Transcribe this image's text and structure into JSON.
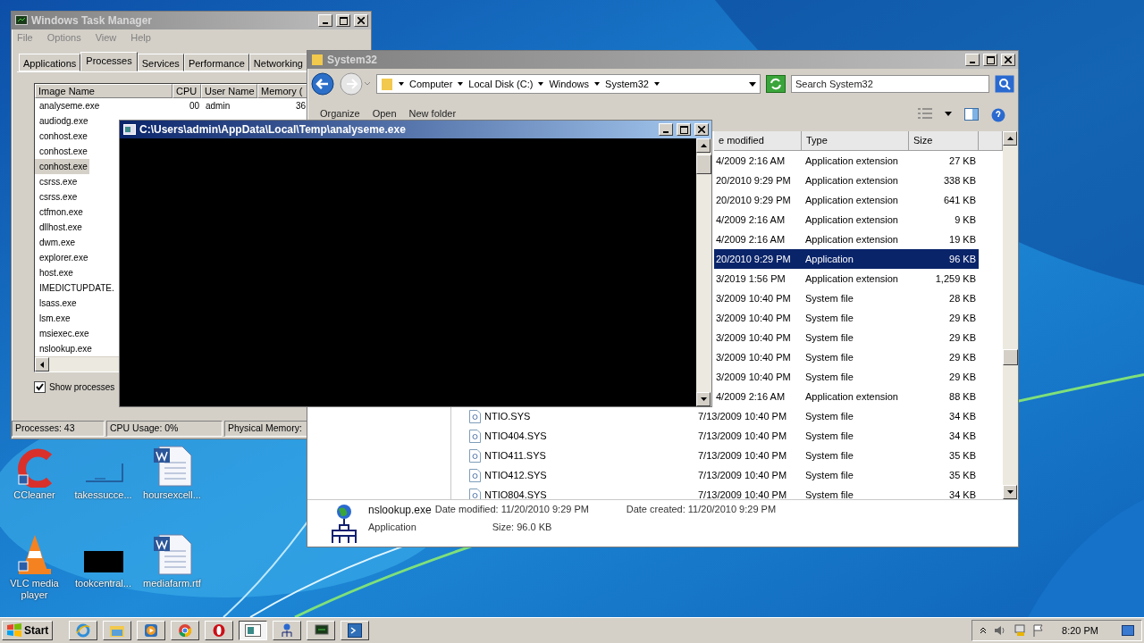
{
  "task_manager": {
    "title": "Windows Task Manager",
    "menu": [
      "File",
      "Options",
      "View",
      "Help"
    ],
    "tabs": [
      {
        "label": "Applications",
        "selected": false
      },
      {
        "label": "Processes",
        "selected": true
      },
      {
        "label": "Services",
        "selected": false
      },
      {
        "label": "Performance",
        "selected": false
      },
      {
        "label": "Networking",
        "selected": false
      }
    ],
    "columns": [
      "Image Name",
      "CPU",
      "User Name",
      "Memory ("
    ],
    "processes": [
      {
        "name": "analyseme.exe",
        "cpu": "00",
        "user": "admin",
        "memory": "36",
        "selected": false
      },
      {
        "name": "audiodg.exe",
        "selected": false
      },
      {
        "name": "conhost.exe",
        "selected": false
      },
      {
        "name": "conhost.exe",
        "selected": false
      },
      {
        "name": "conhost.exe",
        "selected": true
      },
      {
        "name": "csrss.exe",
        "selected": false
      },
      {
        "name": "csrss.exe",
        "selected": false
      },
      {
        "name": "ctfmon.exe",
        "selected": false
      },
      {
        "name": "dllhost.exe",
        "selected": false
      },
      {
        "name": "dwm.exe",
        "selected": false
      },
      {
        "name": "explorer.exe",
        "selected": false
      },
      {
        "name": "host.exe",
        "selected": false
      },
      {
        "name": "IMEDICTUPDATE.",
        "selected": false
      },
      {
        "name": "lsass.exe",
        "selected": false
      },
      {
        "name": "lsm.exe",
        "selected": false
      },
      {
        "name": "msiexec.exe",
        "selected": false
      },
      {
        "name": "nslookup.exe",
        "selected": false
      }
    ],
    "show_processes": {
      "label": "Show processes",
      "checked": true
    },
    "status": [
      "Processes: 43",
      "CPU Usage: 0%",
      "Physical Memory:"
    ]
  },
  "explorer": {
    "title": "System32",
    "breadcrumb": [
      "Computer",
      "Local Disk (C:)",
      "Windows",
      "System32"
    ],
    "search": {
      "placeholder": "Search System32"
    },
    "toolbar": [
      "Organize",
      "Open",
      "New folder"
    ],
    "columns": [
      "e modified",
      "Type",
      "Size"
    ],
    "rows": [
      {
        "date": "4/2009 2:16 AM",
        "type": "Application extension",
        "size": "27 KB",
        "selected": false
      },
      {
        "date": "20/2010 9:29 PM",
        "type": "Application extension",
        "size": "338 KB",
        "selected": false
      },
      {
        "date": "20/2010 9:29 PM",
        "type": "Application extension",
        "size": "641 KB",
        "selected": false
      },
      {
        "date": "4/2009 2:16 AM",
        "type": "Application extension",
        "size": "9 KB",
        "selected": false
      },
      {
        "date": "4/2009 2:16 AM",
        "type": "Application extension",
        "size": "19 KB",
        "selected": false
      },
      {
        "date": "20/2010 9:29 PM",
        "type": "Application",
        "size": "96 KB",
        "selected": true
      },
      {
        "date": "3/2019 1:56 PM",
        "type": "Application extension",
        "size": "1,259 KB",
        "selected": false
      },
      {
        "date": "3/2009 10:40 PM",
        "type": "System file",
        "size": "28 KB",
        "selected": false
      },
      {
        "date": "3/2009 10:40 PM",
        "type": "System file",
        "size": "29 KB",
        "selected": false
      },
      {
        "date": "3/2009 10:40 PM",
        "type": "System file",
        "size": "29 KB",
        "selected": false
      },
      {
        "date": "3/2009 10:40 PM",
        "type": "System file",
        "size": "29 KB",
        "selected": false
      },
      {
        "date": "3/2009 10:40 PM",
        "type": "System file",
        "size": "29 KB",
        "selected": false
      },
      {
        "date": "4/2009 2:16 AM",
        "type": "Application extension",
        "size": "88 KB",
        "selected": false
      },
      {
        "name": "NTIO.SYS",
        "date": "7/13/2009 10:40 PM",
        "type": "System file",
        "size": "34 KB",
        "selected": false
      },
      {
        "name": "NTIO404.SYS",
        "date": "7/13/2009 10:40 PM",
        "type": "System file",
        "size": "34 KB",
        "selected": false
      },
      {
        "name": "NTIO411.SYS",
        "date": "7/13/2009 10:40 PM",
        "type": "System file",
        "size": "35 KB",
        "selected": false
      },
      {
        "name": "NTIO412.SYS",
        "date": "7/13/2009 10:40 PM",
        "type": "System file",
        "size": "35 KB",
        "selected": false
      },
      {
        "name": "NTIO804.SYS",
        "date": "7/13/2009 10:40 PM",
        "type": "System file",
        "size": "34 KB",
        "selected": false
      }
    ],
    "details": {
      "name": "nslookup.exe",
      "modified": "Date modified: 11/20/2010 9:29 PM",
      "created": "Date created: 11/20/2010 9:29 PM",
      "type": "Application",
      "size": "Size: 96.0 KB"
    }
  },
  "console": {
    "title": "C:\\Users\\admin\\AppData\\Local\\Temp\\analyseme.exe"
  },
  "desktop_icons": [
    {
      "label": "CCleaner",
      "kind": "ccleaner"
    },
    {
      "label": "takessucce...",
      "kind": "blank"
    },
    {
      "label": "hoursexcell...",
      "kind": "word"
    },
    {
      "label": "VLC media player",
      "kind": "vlc"
    },
    {
      "label": "tookcentral...",
      "kind": "black"
    },
    {
      "label": "mediafarm.rtf",
      "kind": "word"
    }
  ],
  "taskbar": {
    "start": "Start",
    "apps": [
      {
        "kind": "ie",
        "selected": false
      },
      {
        "kind": "folder",
        "selected": false
      },
      {
        "kind": "media",
        "selected": false
      },
      {
        "kind": "chrome",
        "selected": false
      },
      {
        "kind": "opera",
        "selected": false
      },
      {
        "kind": "taskmgr",
        "selected": true
      },
      {
        "kind": "network",
        "selected": false
      },
      {
        "kind": "monitor",
        "selected": false
      },
      {
        "kind": "console",
        "selected": false
      }
    ],
    "clock": "8:20 PM"
  }
}
